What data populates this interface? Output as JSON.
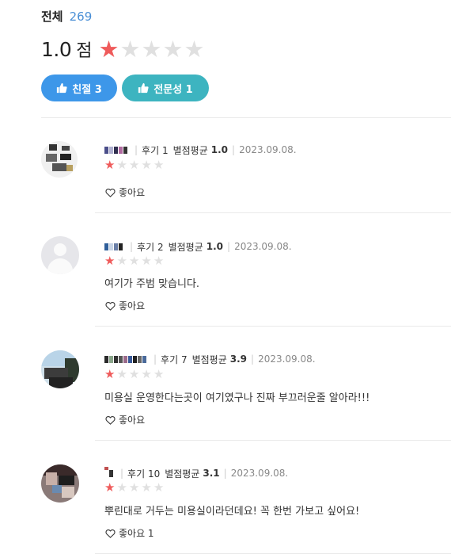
{
  "header": {
    "total_label": "전체",
    "total_count": "269",
    "score": "1.0",
    "score_unit": "점",
    "rating_filled": 1,
    "rating_max": 5,
    "chips": [
      {
        "label": "친절 3",
        "color": "#3d97e9"
      },
      {
        "label": "전문성 1",
        "color": "#3db4c0"
      }
    ]
  },
  "reviews": [
    {
      "review_count": "후기 1",
      "avg_label": "별점평균",
      "avg_value": "1.0",
      "date": "2023.09.08.",
      "rating": 1,
      "text": "",
      "like_label": "좋아요"
    },
    {
      "review_count": "후기 2",
      "avg_label": "별점평균",
      "avg_value": "1.0",
      "date": "2023.09.08.",
      "rating": 1,
      "text": "여기가 주범 맞습니다.",
      "like_label": "좋아요"
    },
    {
      "review_count": "후기 7",
      "avg_label": "별점평균",
      "avg_value": "3.9",
      "date": "2023.09.08.",
      "rating": 1,
      "text": "미용실 운영한다는곳이 여기였구나 진짜 부끄러운줄 알아라!!!",
      "like_label": "좋아요"
    },
    {
      "review_count": "후기 10",
      "avg_label": "별점평균",
      "avg_value": "3.1",
      "date": "2023.09.08.",
      "rating": 1,
      "text": "뿌린대로 거두는 미용실이라던데요! 꼭 한번 가보고 싶어요!",
      "like_label": "좋아요 1"
    }
  ],
  "colors": {
    "star_on": "#ef5b5b",
    "star_off": "#e0e0e0",
    "count": "#4a8fd6"
  },
  "icons": {
    "chip": "thumbs-up-icon",
    "like": "heart-outline-icon"
  }
}
